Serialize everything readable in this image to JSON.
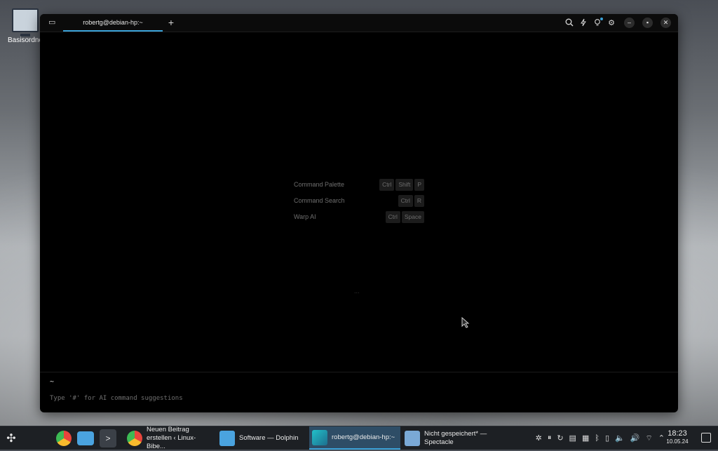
{
  "desktop": {
    "icon_label": "Basisordne"
  },
  "window": {
    "tab_title": "robertg@debian-hp:~",
    "new_tab_symbol": "+",
    "toolbar_icons": [
      "search-icon",
      "bolt-icon",
      "lightbulb-icon",
      "gear-icon"
    ],
    "controls": [
      "minimize",
      "maximize",
      "close"
    ]
  },
  "hints": [
    {
      "label": "Command Palette",
      "keys": [
        "Ctrl",
        "Shift",
        "P"
      ]
    },
    {
      "label": "Command Search",
      "keys": [
        "Ctrl",
        "R"
      ]
    },
    {
      "label": "Warp AI",
      "keys": [
        "Ctrl",
        "Space"
      ]
    }
  ],
  "loading_dots": "...",
  "input": {
    "prompt": "~",
    "placeholder": "Type '#' for AI command suggestions"
  },
  "taskbar": {
    "tasks": [
      {
        "label": "Neuen Beitrag erstellen ‹ Linux-Bibe...",
        "icon": "chrome-icon",
        "color": "#e8453c"
      },
      {
        "label": "Software — Dolphin",
        "icon": "folder-icon",
        "color": "#4aa3df"
      },
      {
        "label": "robertg@debian-hp:~",
        "icon": "warp-icon",
        "color": "#22c0c9"
      },
      {
        "label": "Nicht gespeichert* — Spectacle",
        "icon": "spectacle-icon",
        "color": "#7aa9d6"
      }
    ],
    "clock_time": "18:23",
    "clock_date": "10.05.24"
  },
  "colors": {
    "accent": "#3aa1d8",
    "window_bg": "#000000",
    "taskbar_bg": "#1d2024"
  }
}
